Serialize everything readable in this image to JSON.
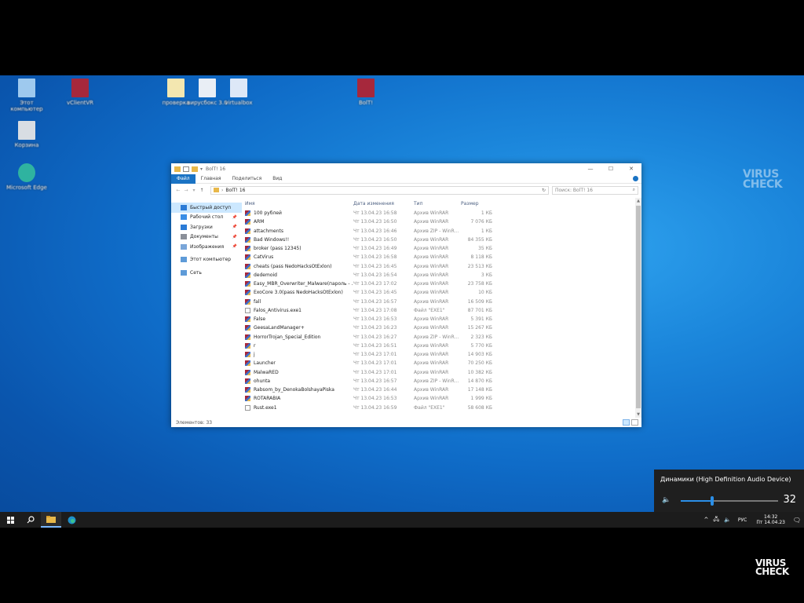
{
  "watermark": {
    "line1": "VIRUS",
    "line2": "CHECK"
  },
  "desktop_icons": [
    {
      "name": "desktop-icon-this-pc",
      "label": "Этот компьютер",
      "icon": "computer-icon",
      "color": "#9ec9ee"
    },
    {
      "name": "desktop-icon-recycle-bin",
      "label": "Корзина",
      "icon": "recycle-bin-icon",
      "color": "#d8dde3"
    },
    {
      "name": "desktop-icon-edge",
      "label": "Microsoft Edge",
      "icon": "edge-icon",
      "color": "#2fb3a0"
    },
    {
      "name": "desktop-icon-archive",
      "label": "vClientVR",
      "icon": "winrar-icon",
      "color": "#a6283c"
    },
    {
      "name": "desktop-icon-text",
      "label": "проверка",
      "icon": "document-icon",
      "color": "#f3e7b0"
    },
    {
      "name": "desktop-icon-setup",
      "label": "вирусбокс 3.0",
      "icon": "document-icon",
      "color": "#e9eef5"
    },
    {
      "name": "desktop-icon-doc",
      "label": "virtualbox",
      "icon": "document-icon",
      "color": "#dde8f7"
    },
    {
      "name": "desktop-icon-bolt",
      "label": "BolT!",
      "icon": "winrar-icon",
      "color": "#a6283c"
    }
  ],
  "explorer": {
    "title": "BolT! 16",
    "ribbon_tabs": [
      "Файл",
      "Главная",
      "Поделиться",
      "Вид"
    ],
    "address": "BolT! 16",
    "search_placeholder": "Поиск: BolT! 16",
    "nav_items": [
      {
        "label": "Быстрый доступ",
        "icon": "star-icon",
        "color": "#2b7bd6",
        "selected": true,
        "pinned": false
      },
      {
        "label": "Рабочий стол",
        "icon": "desktop-folder-icon",
        "color": "#3a8ee6",
        "selected": false,
        "pinned": true
      },
      {
        "label": "Загрузки",
        "icon": "download-icon",
        "color": "#2b7bd6",
        "selected": false,
        "pinned": true
      },
      {
        "label": "Документы",
        "icon": "documents-icon",
        "color": "#8a8f99",
        "selected": false,
        "pinned": true
      },
      {
        "label": "Изображения",
        "icon": "pictures-icon",
        "color": "#7aa6d9",
        "selected": false,
        "pinned": true
      },
      {
        "gap": true
      },
      {
        "label": "Этот компьютер",
        "icon": "computer-icon",
        "color": "#5e9bd8",
        "selected": false,
        "pinned": false
      },
      {
        "gap": true
      },
      {
        "label": "Сеть",
        "icon": "network-icon",
        "color": "#5e9bd8",
        "selected": false,
        "pinned": false
      }
    ],
    "columns": {
      "name": "Имя",
      "date": "Дата изменения",
      "type": "Тип",
      "size": "Размер"
    },
    "files": [
      {
        "name": "100 рублей",
        "date": "Чт 13.04.23 16:58",
        "type": "Архив WinRAR",
        "size": "1 КБ",
        "icon": "rar"
      },
      {
        "name": "ARM",
        "date": "Чт 13.04.23 16:50",
        "type": "Архив WinRAR",
        "size": "7 076 КБ",
        "icon": "rar"
      },
      {
        "name": "attachments",
        "date": "Чт 13.04.23 16:46",
        "type": "Архив ZIP - WinR...",
        "size": "1 КБ",
        "icon": "rar"
      },
      {
        "name": "Bad Windows!!",
        "date": "Чт 13.04.23 16:50",
        "type": "Архив WinRAR",
        "size": "84 355 КБ",
        "icon": "rar"
      },
      {
        "name": "broker (pass 12345)",
        "date": "Чт 13.04.23 16:49",
        "type": "Архив WinRAR",
        "size": "35 КБ",
        "icon": "rar"
      },
      {
        "name": "CatVirus",
        "date": "Чт 13.04.23 16:58",
        "type": "Архив WinRAR",
        "size": "8 118 КБ",
        "icon": "rar"
      },
      {
        "name": "cheats (pass NedoHacksOtExlon)",
        "date": "Чт 13.04.23 16:45",
        "type": "Архив WinRAR",
        "size": "23 513 КБ",
        "icon": "rar"
      },
      {
        "name": "dedemoid",
        "date": "Чт 13.04.23 16:54",
        "type": "Архив WinRAR",
        "size": "3 КБ",
        "icon": "rar"
      },
      {
        "name": "Easy_MBR_Overwriter_Malware(пароль - ...",
        "date": "Чт 13.04.23 17:02",
        "type": "Архив WinRAR",
        "size": "23 758 КБ",
        "icon": "rar"
      },
      {
        "name": "ExoCore 3.0(pass NedoHacksOtExlon)",
        "date": "Чт 13.04.23 16:45",
        "type": "Архив WinRAR",
        "size": "10 КБ",
        "icon": "rar"
      },
      {
        "name": "fall",
        "date": "Чт 13.04.23 16:57",
        "type": "Архив WinRAR",
        "size": "16 509 КБ",
        "icon": "rar"
      },
      {
        "name": "Falos_Antivirus.exe1",
        "date": "Чт 13.04.23 17:08",
        "type": "Файл \"EXE1\"",
        "size": "87 701 КБ",
        "icon": "exe"
      },
      {
        "name": "False",
        "date": "Чт 13.04.23 16:53",
        "type": "Архив WinRAR",
        "size": "5 391 КБ",
        "icon": "rar"
      },
      {
        "name": "GeesaLandManager+",
        "date": "Чт 13.04.23 16:23",
        "type": "Архив WinRAR",
        "size": "15 267 КБ",
        "icon": "rar"
      },
      {
        "name": "HorrorTrojan_Special_Edition",
        "date": "Чт 13.04.23 16:27",
        "type": "Архив ZIP - WinR...",
        "size": "2 323 КБ",
        "icon": "rar"
      },
      {
        "name": "r",
        "date": "Чт 13.04.23 16:51",
        "type": "Архив WinRAR",
        "size": "5 770 КБ",
        "icon": "rar"
      },
      {
        "name": "j",
        "date": "Чт 13.04.23 17:01",
        "type": "Архив WinRAR",
        "size": "14 903 КБ",
        "icon": "rar"
      },
      {
        "name": "Launcher",
        "date": "Чт 13.04.23 17:01",
        "type": "Архив WinRAR",
        "size": "70 250 КБ",
        "icon": "rar"
      },
      {
        "name": "MalwaRED",
        "date": "Чт 13.04.23 17:01",
        "type": "Архив WinRAR",
        "size": "10 382 КБ",
        "icon": "rar"
      },
      {
        "name": "ohunta",
        "date": "Чт 13.04.23 16:57",
        "type": "Архив ZIP - WinR...",
        "size": "14 870 КБ",
        "icon": "rar"
      },
      {
        "name": "Rabsom_by_DenokaBolshayaPiska",
        "date": "Чт 13.04.23 16:44",
        "type": "Архив WinRAR",
        "size": "17 148 КБ",
        "icon": "rar"
      },
      {
        "name": "ROTARABIA",
        "date": "Чт 13.04.23 16:53",
        "type": "Архив WinRAR",
        "size": "1 999 КБ",
        "icon": "rar"
      },
      {
        "name": "Rust.exe1",
        "date": "Чт 13.04.23 16:59",
        "type": "Файл \"EXE1\"",
        "size": "58 608 КБ",
        "icon": "exe"
      }
    ],
    "status": "Элементов: 33"
  },
  "volume": {
    "device": "Динамики (High Definition Audio Device)",
    "level": 32
  },
  "taskbar": {
    "language": "РУС",
    "time": "14:32",
    "date": "Пт 14.04.23"
  },
  "colors": {
    "accent": "#1a73c4",
    "taskbar": "#1c1c1c",
    "flyout": "#1f1f1f",
    "slider": "#2b8fe8"
  }
}
